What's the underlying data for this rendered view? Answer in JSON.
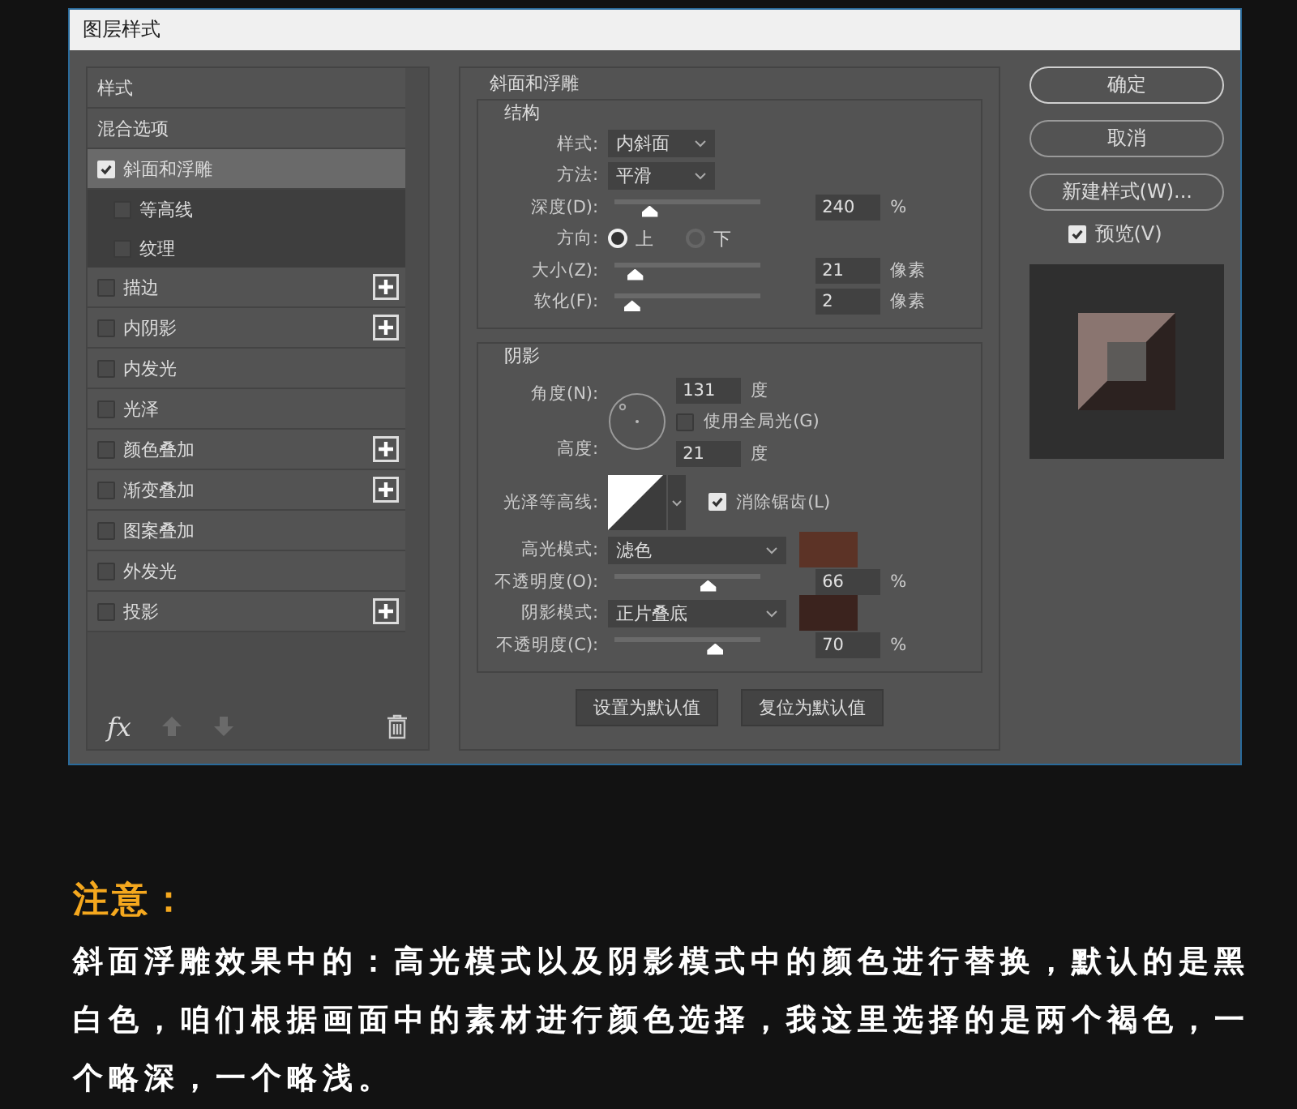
{
  "dialog": {
    "title": "图层样式"
  },
  "style_list": {
    "items": [
      {
        "kind": "header",
        "label": "样式",
        "selected": false
      },
      {
        "kind": "header",
        "label": "混合选项",
        "selected": false
      },
      {
        "kind": "effect",
        "label": "斜面和浮雕",
        "checked": true,
        "selected": true,
        "plus": false,
        "children": [
          {
            "label": "等高线",
            "checked": false,
            "selected": false
          },
          {
            "label": "纹理",
            "checked": false,
            "selected": false
          }
        ]
      },
      {
        "kind": "effect",
        "label": "描边",
        "checked": false,
        "selected": false,
        "plus": true
      },
      {
        "kind": "effect",
        "label": "内阴影",
        "checked": false,
        "selected": false,
        "plus": true
      },
      {
        "kind": "effect",
        "label": "内发光",
        "checked": false,
        "selected": false,
        "plus": false
      },
      {
        "kind": "effect",
        "label": "光泽",
        "checked": false,
        "selected": false,
        "plus": false
      },
      {
        "kind": "effect",
        "label": "颜色叠加",
        "checked": false,
        "selected": false,
        "plus": true
      },
      {
        "kind": "effect",
        "label": "渐变叠加",
        "checked": false,
        "selected": false,
        "plus": true
      },
      {
        "kind": "effect",
        "label": "图案叠加",
        "checked": false,
        "selected": false,
        "plus": false
      },
      {
        "kind": "effect",
        "label": "外发光",
        "checked": false,
        "selected": false,
        "plus": false
      },
      {
        "kind": "effect",
        "label": "投影",
        "checked": false,
        "selected": false,
        "plus": true
      }
    ],
    "fx_label": "fx"
  },
  "bevel_emboss": {
    "title": "斜面和浮雕",
    "structure": {
      "title": "结构",
      "rows": [
        {
          "kind": "select",
          "label": "样式:",
          "value": "内斜面"
        },
        {
          "kind": "select",
          "label": "方法:",
          "value": "平滑"
        },
        {
          "kind": "slider",
          "label": "深度(D):",
          "level": 0.24,
          "value": "240",
          "unit": "%"
        },
        {
          "kind": "radio",
          "label": "方向:",
          "options": [
            {
              "label": "上",
              "selected": true
            },
            {
              "label": "下",
              "selected": false
            }
          ]
        },
        {
          "kind": "slider",
          "label": "大小(Z):",
          "level": 0.14,
          "value": "21",
          "unit": "像素"
        },
        {
          "kind": "slider",
          "label": "软化(F):",
          "level": 0.12,
          "value": "2",
          "unit": "像素"
        }
      ]
    },
    "shading": {
      "title": "阴影",
      "angle": {
        "label": "角度(N):",
        "value": "131",
        "unit": "度"
      },
      "global_light": {
        "label": "使用全局光(G)",
        "checked": false
      },
      "altitude": {
        "label": "高度:",
        "value": "21",
        "unit": "度"
      },
      "gloss_contour": {
        "label": "光泽等高线:"
      },
      "anti_aliased": {
        "label": "消除锯齿(L)",
        "checked": true
      },
      "rows": [
        {
          "kind": "blend",
          "label": "高光模式:",
          "value": "滤色",
          "color": "#5c3326"
        },
        {
          "kind": "slider",
          "label": "不透明度(O):",
          "level": 0.64,
          "value": "66",
          "unit": "%"
        },
        {
          "kind": "blend",
          "label": "阴影模式:",
          "value": "正片叠底",
          "color": "#3b231e"
        },
        {
          "kind": "slider",
          "label": "不透明度(C):",
          "level": 0.69,
          "value": "70",
          "unit": "%"
        }
      ]
    },
    "buttons": [
      "设置为默认值",
      "复位为默认值"
    ]
  },
  "actions": {
    "buttons": [
      {
        "label": "确定",
        "primary": true
      },
      {
        "label": "取消",
        "primary": false
      },
      {
        "label": "新建样式(W)...",
        "primary": false
      }
    ],
    "preview": {
      "label": "预览(V)",
      "checked": true
    }
  },
  "note": {
    "heading": "注意：",
    "text": "斜面浮雕效果中的：高光模式以及阴影模式中的颜色进行替换，默认的是黑白色，咱们根据画面中的素材进行颜色选择，我这里选择的是两个褐色，一个略深，一个略浅。"
  }
}
